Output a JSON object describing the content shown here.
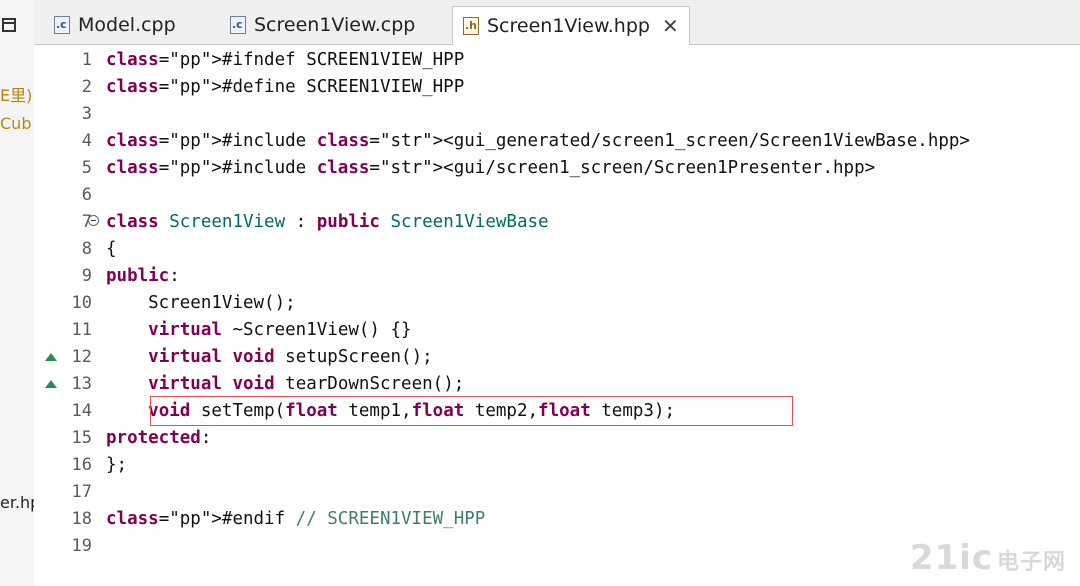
{
  "sidebar": {
    "items": [
      {
        "label": "E里)"
      },
      {
        "label": "Cub"
      },
      {
        "label": "er.hp"
      }
    ]
  },
  "tabs": [
    {
      "label": "Model.cpp",
      "icon": "c-file-icon"
    },
    {
      "label": "Screen1View.cpp",
      "icon": "c-file-icon"
    },
    {
      "label": "Screen1View.hpp",
      "icon": "h-file-icon",
      "active": true
    }
  ],
  "editor": {
    "lines": [
      {
        "n": "1",
        "text": "#ifndef SCREEN1VIEW_HPP"
      },
      {
        "n": "2",
        "text": "#define SCREEN1VIEW_HPP"
      },
      {
        "n": "3",
        "text": ""
      },
      {
        "n": "4",
        "text": "#include <gui_generated/screen1_screen/Screen1ViewBase.hpp>"
      },
      {
        "n": "5",
        "text": "#include <gui/screen1_screen/Screen1Presenter.hpp>"
      },
      {
        "n": "6",
        "text": ""
      },
      {
        "n": "7",
        "text": "class Screen1View : public Screen1ViewBase"
      },
      {
        "n": "8",
        "text": "{"
      },
      {
        "n": "9",
        "text": "public:"
      },
      {
        "n": "10",
        "text": "    Screen1View();"
      },
      {
        "n": "11",
        "text": "    virtual ~Screen1View() {}"
      },
      {
        "n": "12",
        "text": "    virtual void setupScreen();"
      },
      {
        "n": "13",
        "text": "    virtual void tearDownScreen();"
      },
      {
        "n": "14",
        "text": "    void setTemp(float temp1,float temp2,float temp3);"
      },
      {
        "n": "15",
        "text": "protected:"
      },
      {
        "n": "16",
        "text": "};"
      },
      {
        "n": "17",
        "text": ""
      },
      {
        "n": "18",
        "text": "#endif // SCREEN1VIEW_HPP"
      },
      {
        "n": "19",
        "text": ""
      }
    ]
  },
  "colors": {
    "keyword": "#7f0055",
    "string": "#2a00ff",
    "type": "#006a6a",
    "comment": "#3f7f5f",
    "highlight_box": "#e05050"
  },
  "watermark": {
    "text": "21ic",
    "sub": "电子网"
  }
}
